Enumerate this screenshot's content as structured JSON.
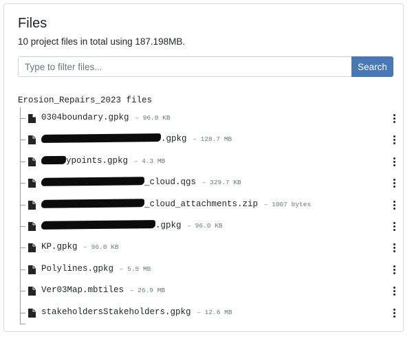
{
  "page": {
    "title": "Files",
    "summary": "10 project files in total using 187.198MB."
  },
  "search": {
    "placeholder": "Type to filter files...",
    "button_label": "Search"
  },
  "tree": {
    "root_label": "Erosion_Repairs_2023 files",
    "files": [
      {
        "name": "0304boundary.gpkg",
        "size": "96.0 KB",
        "redacted_prefix": false
      },
      {
        "name": ".gpkg",
        "size": "128.7 MB",
        "redacted_prefix": true
      },
      {
        "name": "ypoints.gpkg",
        "size": "4.3 MB",
        "redacted_prefix": true
      },
      {
        "name": "_cloud.qgs",
        "size": "329.7 KB",
        "redacted_prefix": true
      },
      {
        "name": "_cloud_attachments.zip",
        "size": "1007 bytes",
        "redacted_prefix": true
      },
      {
        "name": ".gpkg",
        "size": "96.0 KB",
        "redacted_prefix": true
      },
      {
        "name": "KP.gpkg",
        "size": "96.0 KB",
        "redacted_prefix": false
      },
      {
        "name": "Polylines.gpkg",
        "size": "5.5 MB",
        "redacted_prefix": false
      },
      {
        "name": "Ver03Map.mbtiles",
        "size": "26.9 MB",
        "redacted_prefix": false
      },
      {
        "name": "stakeholdersStakeholders.gpkg",
        "size": "12.6 MB",
        "redacted_prefix": false
      }
    ]
  },
  "icons": {
    "file": "file-icon",
    "menu": "kebab-menu-icon"
  }
}
